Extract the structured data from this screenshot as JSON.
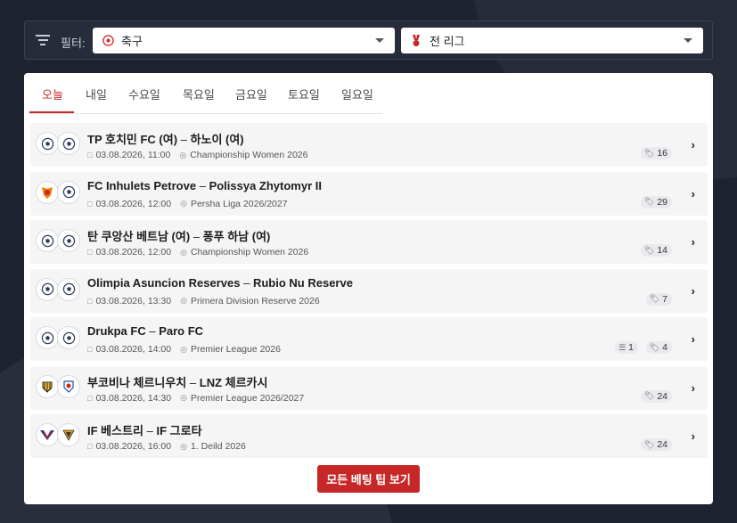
{
  "filter": {
    "label": "필터:",
    "sport_value": "축구",
    "league_value": "전 리그"
  },
  "tabs": [
    "오늘",
    "내일",
    "수요일",
    "목요일",
    "금요일",
    "토요일",
    "일요일"
  ],
  "active_tab": "오늘",
  "matches": [
    {
      "home": "TP 호치민 FC (여)",
      "away": "하노이 (여)",
      "datetime": "03.08.2026, 11:00",
      "league": "Championship Women 2026",
      "tips": "16"
    },
    {
      "home": "FC Inhulets Petrove",
      "away": "Polissya Zhytomyr II",
      "datetime": "03.08.2026, 12:00",
      "league": "Persha Liga 2026/2027",
      "tips": "29"
    },
    {
      "home": "탄 쿠앙산 베트남 (여)",
      "away": "퐁푸 하남 (여)",
      "datetime": "03.08.2026, 12:00",
      "league": "Championship Women 2026",
      "tips": "14"
    },
    {
      "home": "Olimpia Asuncion Reserves",
      "away": "Rubio Nu Reserve",
      "datetime": "03.08.2026, 13:30",
      "league": "Primera Division Reserve 2026",
      "tips": "7"
    },
    {
      "home": "Drukpa FC",
      "away": "Paro FC",
      "datetime": "03.08.2026, 14:00",
      "league": "Premier League 2026",
      "tips": "4",
      "predictions": "1"
    },
    {
      "home": "부코비나 체르니우치",
      "away": "LNZ 체르카시",
      "datetime": "03.08.2026, 14:30",
      "league": "Premier League 2026/2027",
      "tips": "24"
    },
    {
      "home": "IF 베스트리",
      "away": "IF 그로타",
      "datetime": "03.08.2026, 16:00",
      "league": "1. Deild 2026",
      "tips": "24"
    }
  ],
  "separator": "–",
  "cta_label": "모든 베팅 팁 보기",
  "colors": {
    "accent": "#c62828",
    "background": "#1e2330"
  }
}
